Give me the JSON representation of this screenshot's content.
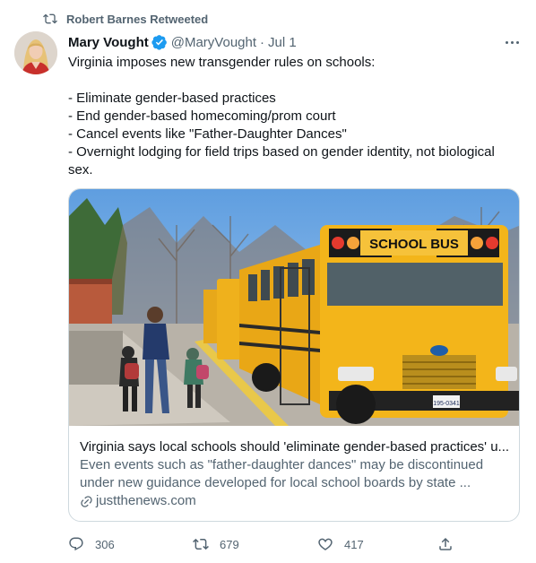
{
  "retweet": {
    "label": "Robert Barnes Retweeted",
    "icon": "retweet-icon"
  },
  "tweet": {
    "author_name": "Mary Vought",
    "verified": true,
    "handle": "@MaryVought",
    "separator": "·",
    "date": "Jul 1",
    "text_lines": [
      "Virginia imposes new transgender rules on schools:",
      "",
      "- Eliminate gender-based practices",
      "- End gender-based homecoming/prom court",
      "- Cancel events like \"Father-Daughter Dances\"",
      "- Overnight lodging for field trips based on gender identity, not biological",
      "sex."
    ]
  },
  "card": {
    "image_bus_sign": "SCHOOL BUS",
    "image_plate": "195-0341",
    "title": "Virginia says local schools should 'eliminate gender-based practices' u...",
    "description_line1": "Even events such as \"father-daughter dances\" may be discontinued",
    "description_line2": "under new guidance developed for local school boards by state ...",
    "domain": "justthenews.com"
  },
  "actions": {
    "reply_count": "306",
    "retweet_count": "679",
    "like_count": "417"
  },
  "colors": {
    "text": "#0f1419",
    "secondary": "#536471",
    "verified": "#1d9bf0",
    "border": "#cfd9de",
    "bus_yellow": "#f3b51a"
  }
}
